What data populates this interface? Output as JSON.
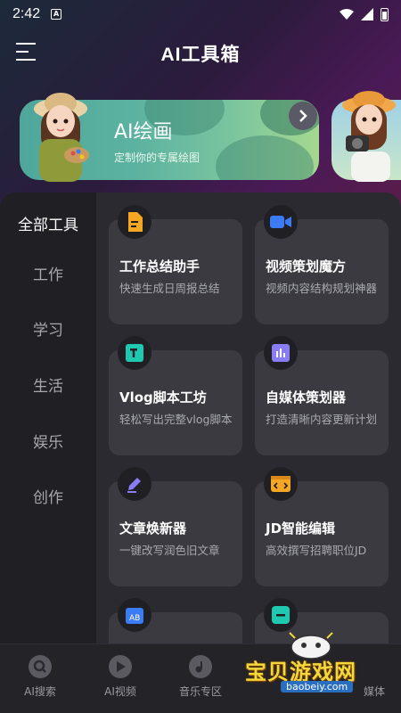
{
  "status_bar": {
    "time": "2:42",
    "notif_letter": "A"
  },
  "app_bar": {
    "title": "AI工具箱"
  },
  "banner": {
    "title": "AI绘画",
    "subtitle": "定制你的专属绘图"
  },
  "categories": [
    {
      "label": "全部工具",
      "active": true
    },
    {
      "label": "工作",
      "active": false
    },
    {
      "label": "学习",
      "active": false
    },
    {
      "label": "生活",
      "active": false
    },
    {
      "label": "娱乐",
      "active": false
    },
    {
      "label": "创作",
      "active": false
    }
  ],
  "cards": [
    {
      "title": "工作总结助手",
      "desc": "快速生成日周报总结",
      "icon": "document-icon",
      "color": "#f5a623"
    },
    {
      "title": "视频策划魔方",
      "desc": "视频内容结构规划神器",
      "icon": "video-camera-icon",
      "color": "#3b7cf5"
    },
    {
      "title": "Vlog脚本工坊",
      "desc": "轻松写出完整vlog脚本",
      "icon": "script-icon",
      "color": "#1fc8b0"
    },
    {
      "title": "自媒体策划器",
      "desc": "打造清晰内容更新计划",
      "icon": "chart-board-icon",
      "color": "#8a7cf5"
    },
    {
      "title": "文章焕新器",
      "desc": "一键改写润色旧文章",
      "icon": "pen-icon",
      "color": "#8a7cf5"
    },
    {
      "title": "JD智能编辑",
      "desc": "高效撰写招聘职位JD",
      "icon": "code-window-icon",
      "color": "#f5a623"
    },
    {
      "title": "",
      "desc": "",
      "icon": "calendar-ab-icon",
      "color": "#3b7cf5"
    },
    {
      "title": "",
      "desc": "",
      "icon": "minus-box-icon",
      "color": "#1fc8b0"
    }
  ],
  "tabs": [
    {
      "label": "AI搜索",
      "icon": "search-icon"
    },
    {
      "label": "AI视频",
      "icon": "play-icon"
    },
    {
      "label": "音乐专区",
      "icon": "music-note-icon"
    },
    {
      "label": "媒体",
      "icon": "media-icon"
    }
  ],
  "watermark": {
    "text": "宝贝游戏网",
    "url": "baobeiy.com"
  }
}
